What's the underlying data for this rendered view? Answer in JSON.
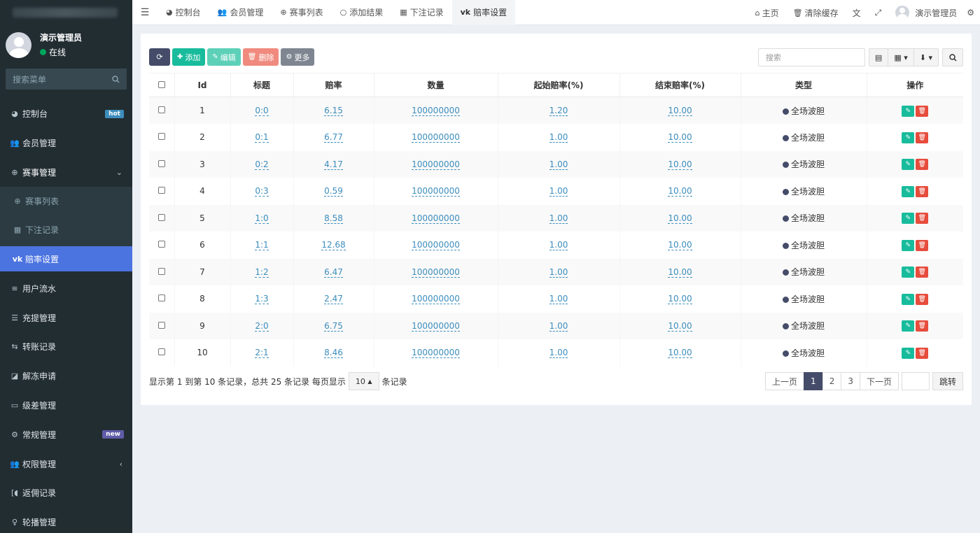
{
  "sidebar": {
    "user_name": "演示管理员",
    "user_status": "在线",
    "search_placeholder": "搜索菜单",
    "items": [
      {
        "label": "控制台",
        "icon": "dashboard-icon",
        "badge": "hot"
      },
      {
        "label": "会员管理",
        "icon": "users-icon"
      },
      {
        "label": "赛事管理",
        "icon": "globe-icon"
      },
      {
        "label": "用户流水",
        "icon": "list-icon"
      },
      {
        "label": "充提管理",
        "icon": "list-alt-icon"
      },
      {
        "label": "转账记录",
        "icon": "transfer-icon"
      },
      {
        "label": "解冻申请",
        "icon": "chart-icon"
      },
      {
        "label": "级差管理",
        "icon": "window-icon"
      },
      {
        "label": "常规管理",
        "icon": "cogs-icon",
        "badge": "new"
      },
      {
        "label": "权限管理",
        "icon": "group-icon"
      },
      {
        "label": "返佣记录",
        "icon": "bracket-icon"
      },
      {
        "label": "轮播管理",
        "icon": "balloon-icon"
      }
    ],
    "sub_items": [
      {
        "label": "赛事列表",
        "icon": "globe-icon"
      },
      {
        "label": "下注记录",
        "icon": "calendar-icon"
      },
      {
        "label": "赔率设置",
        "icon": "vk-icon"
      }
    ]
  },
  "topbar": {
    "tabs": [
      {
        "label": "控制台",
        "icon": "dashboard-icon"
      },
      {
        "label": "会员管理",
        "icon": "users-icon"
      },
      {
        "label": "赛事列表",
        "icon": "globe-icon"
      },
      {
        "label": "添加结果",
        "icon": "circle-icon"
      },
      {
        "label": "下注记录",
        "icon": "calendar-icon"
      },
      {
        "label": "赔率设置",
        "icon": "vk-icon"
      }
    ],
    "home": "主页",
    "clear_cache": "清除缓存",
    "admin_name": "演示管理员"
  },
  "toolbar": {
    "add": "添加",
    "edit": "编辑",
    "delete": "删除",
    "more": "更多",
    "search_placeholder": "搜索"
  },
  "table": {
    "headers": [
      "Id",
      "标题",
      "赔率",
      "数量",
      "起始赔率(%)",
      "结束赔率(%)",
      "类型",
      "操作"
    ],
    "rows": [
      {
        "id": "1",
        "title": "0:0",
        "odds": "6.15",
        "qty": "100000000",
        "start": "1.20",
        "end": "10.00",
        "type": "全场波胆"
      },
      {
        "id": "2",
        "title": "0:1",
        "odds": "6.77",
        "qty": "100000000",
        "start": "1.00",
        "end": "10.00",
        "type": "全场波胆"
      },
      {
        "id": "3",
        "title": "0:2",
        "odds": "4.17",
        "qty": "100000000",
        "start": "1.00",
        "end": "10.00",
        "type": "全场波胆"
      },
      {
        "id": "4",
        "title": "0:3",
        "odds": "0.59",
        "qty": "100000000",
        "start": "1.00",
        "end": "10.00",
        "type": "全场波胆"
      },
      {
        "id": "5",
        "title": "1:0",
        "odds": "8.58",
        "qty": "100000000",
        "start": "1.00",
        "end": "10.00",
        "type": "全场波胆"
      },
      {
        "id": "6",
        "title": "1:1",
        "odds": "12.68",
        "qty": "100000000",
        "start": "1.00",
        "end": "10.00",
        "type": "全场波胆"
      },
      {
        "id": "7",
        "title": "1:2",
        "odds": "6.47",
        "qty": "100000000",
        "start": "1.00",
        "end": "10.00",
        "type": "全场波胆"
      },
      {
        "id": "8",
        "title": "1:3",
        "odds": "2.47",
        "qty": "100000000",
        "start": "1.00",
        "end": "10.00",
        "type": "全场波胆"
      },
      {
        "id": "9",
        "title": "2:0",
        "odds": "6.75",
        "qty": "100000000",
        "start": "1.00",
        "end": "10.00",
        "type": "全场波胆"
      },
      {
        "id": "10",
        "title": "2:1",
        "odds": "8.46",
        "qty": "100000000",
        "start": "1.00",
        "end": "10.00",
        "type": "全场波胆"
      }
    ]
  },
  "footer": {
    "summary": "显示第 1 到第 10 条记录，总共 25 条记录 每页显示",
    "page_size": "10",
    "unit": "条记录",
    "prev": "上一页",
    "pages": [
      "1",
      "2",
      "3"
    ],
    "next": "下一页",
    "jump": "跳转"
  },
  "colors": {
    "sidebar_bg": "#222d32",
    "active_blue": "#4c74e0",
    "primary_dark": "#444c69",
    "success": "#18bc9c",
    "danger": "#e74c3c",
    "link": "#3c8dbc"
  }
}
